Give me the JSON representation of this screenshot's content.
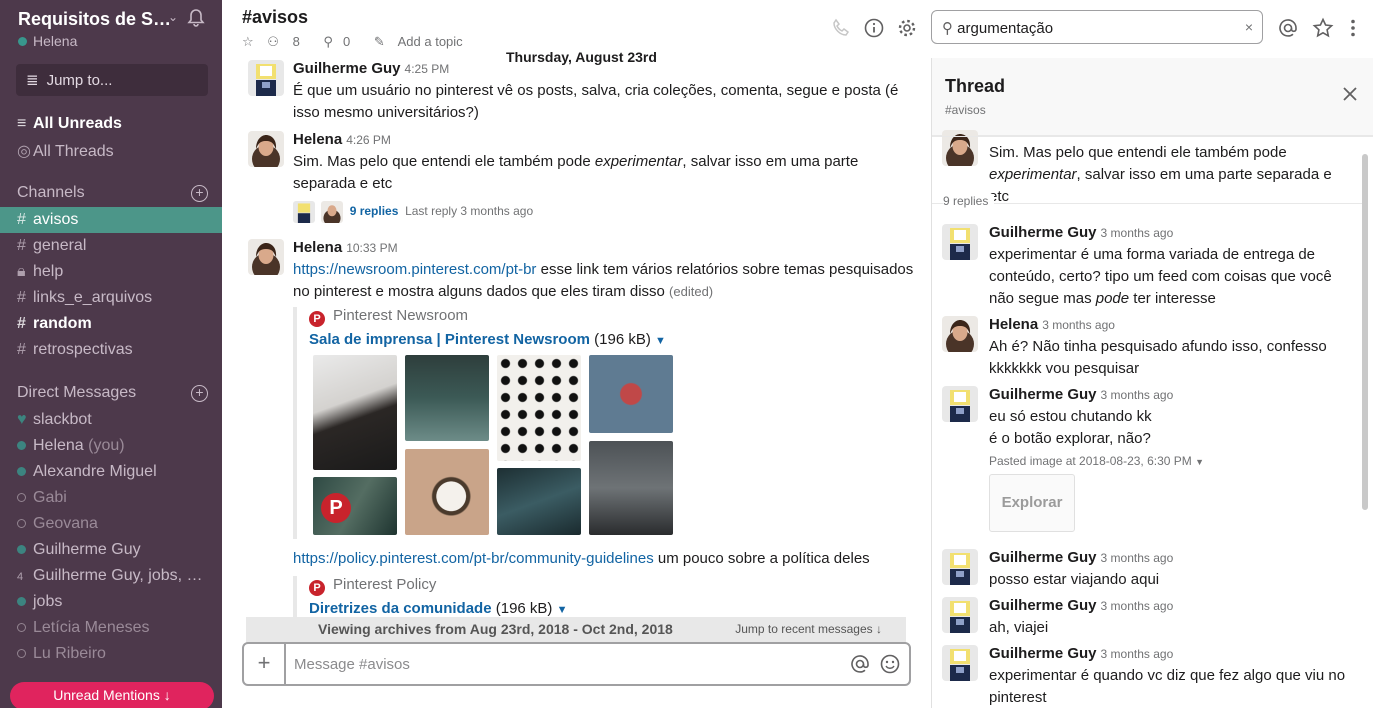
{
  "workspace": {
    "name": "Requisitos de Software",
    "user": "Helena"
  },
  "sidebar": {
    "jump_label": "Jump to...",
    "all_unreads": "All Unreads",
    "all_threads": "All Threads",
    "channels_header": "Channels",
    "channels": [
      {
        "name": "avisos",
        "prefix": "#"
      },
      {
        "name": "general",
        "prefix": "#"
      },
      {
        "name": "help",
        "prefix": "lock"
      },
      {
        "name": "links_e_arquivos",
        "prefix": "#"
      },
      {
        "name": "random",
        "prefix": "#"
      },
      {
        "name": "retrospectivas",
        "prefix": "#"
      }
    ],
    "dm_header": "Direct Messages",
    "dms": [
      {
        "name": "slackbot"
      },
      {
        "name": "Helena",
        "suffix": "(you)"
      },
      {
        "name": "Alexandre Miguel"
      },
      {
        "name": "Gabi"
      },
      {
        "name": "Geovana"
      },
      {
        "name": "Guilherme Guy"
      },
      {
        "name": "Guilherme Guy, jobs, L...",
        "prefix": "4"
      },
      {
        "name": "jobs"
      },
      {
        "name": "Letícia Meneses"
      },
      {
        "name": "Lu Ribeiro"
      }
    ],
    "unread_mentions": "Unread Mentions"
  },
  "header": {
    "channel": "#avisos",
    "members": "8",
    "pins": "0",
    "add_topic": "Add a topic",
    "search_value": "argumentação",
    "clear": "×"
  },
  "messages": {
    "day": "Thursday, August 23rd",
    "m1": {
      "sender": "Guilherme Guy",
      "time": "4:25 PM",
      "text": "É que um usuário no pinterest vê os posts, salva, cria coleções, comenta, segue e posta (é isso mesmo universitários?)"
    },
    "m2": {
      "sender": "Helena",
      "time": "4:26 PM",
      "text_a": "Sim. Mas pelo que entendi ele também pode ",
      "text_em": "experimentar",
      "text_b": ", salvar isso em uma parte separada e etc",
      "replies": "9 replies",
      "last_reply": "Last reply 3 months ago"
    },
    "m3": {
      "sender": "Helena",
      "time": "10:33 PM",
      "link": "https://newsroom.pinterest.com/pt-br",
      "text": " esse link tem vários relatórios sobre temas pesquisados no pinterest e mostra alguns dados que eles tiram disso",
      "edited": "(edited)",
      "unfurl_service": "Pinterest Newsroom",
      "unfurl_title": "Sala de imprensa | Pinterest Newsroom",
      "unfurl_size": "(196 kB)"
    },
    "m4": {
      "link": "https://policy.pinterest.com/pt-br/community-guidelines",
      "text": " um pouco sobre a política deles",
      "unfurl_service": "Pinterest Policy",
      "unfurl_title": "Diretrizes da comunidade",
      "unfurl_size": "(196 kB)"
    }
  },
  "archive": {
    "label": "Viewing archives from Aug 23rd, 2018 - Oct 2nd, 2018",
    "jump": "Jump to recent messages"
  },
  "composer": {
    "placeholder": "Message #avisos"
  },
  "thread": {
    "title": "Thread",
    "channel": "#avisos",
    "parent_a": "Sim. Mas pelo que entendi ele também pode ",
    "parent_em": "experimentar",
    "parent_b": ", salvar isso em uma parte separada e etc",
    "reply_count": "9 replies",
    "replies": [
      {
        "sender": "Guilherme Guy",
        "time": "3 months ago",
        "text_a": "experimentar é uma forma variada de entrega de conteúdo, certo? tipo um feed com coisas que você não segue mas ",
        "text_em": "pode",
        "text_b": " ter interesse"
      },
      {
        "sender": "Helena",
        "time": "3 months ago",
        "text": "Ah é? Não tinha pesquisado afundo isso, confesso kkkkkkk vou pesquisar"
      },
      {
        "sender": "Guilherme Guy",
        "time": "3 months ago",
        "line1": "eu só estou chutando kk",
        "line2": "é o botão explorar, não?",
        "pasted": "Pasted image at 2018-08-23, 6:30 PM",
        "thumb": "Explorar"
      },
      {
        "sender": "Guilherme Guy",
        "time": "3 months ago",
        "text": "posso estar viajando aqui"
      },
      {
        "sender": "Guilherme Guy",
        "time": "3 months ago",
        "text": "ah, viajei"
      },
      {
        "sender": "Guilherme Guy",
        "time": "3 months ago",
        "text": "experimentar é quando vc diz que fez algo que viu no pinterest"
      }
    ]
  },
  "colors": {
    "sidebar": "#4d394b",
    "active_channel": "#4c9689",
    "link": "#1264a3",
    "mention_btn": "#e0245e",
    "presence": "#38978d"
  }
}
